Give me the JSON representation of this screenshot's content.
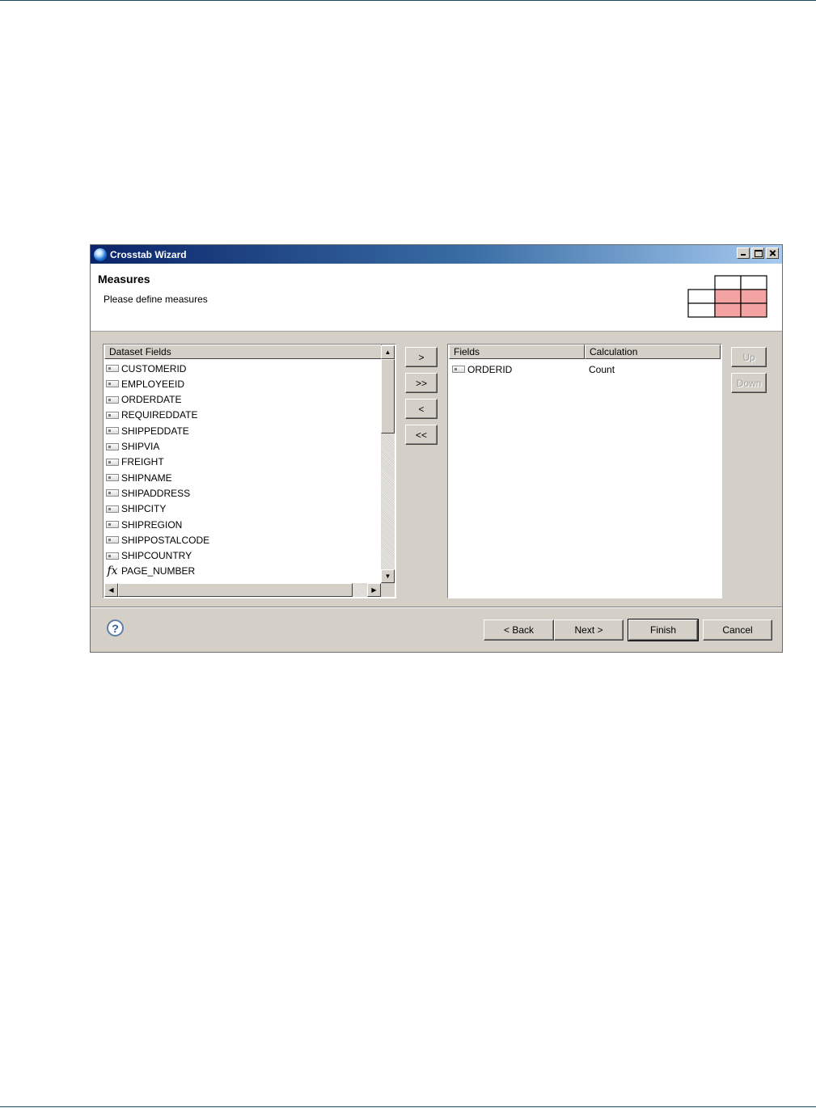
{
  "window": {
    "title": "Crosstab Wizard",
    "controls": {
      "minimize": "_",
      "maximize": "□",
      "close": "×"
    }
  },
  "header": {
    "title": "Measures",
    "description": "Please define measures"
  },
  "dataset_fields": {
    "header": "Dataset Fields",
    "items": [
      {
        "label": "CUSTOMERID",
        "icon": "field-icon"
      },
      {
        "label": "EMPLOYEEID",
        "icon": "field-icon"
      },
      {
        "label": "ORDERDATE",
        "icon": "field-icon"
      },
      {
        "label": "REQUIREDDATE",
        "icon": "field-icon"
      },
      {
        "label": "SHIPPEDDATE",
        "icon": "field-icon"
      },
      {
        "label": "SHIPVIA",
        "icon": "field-icon"
      },
      {
        "label": "FREIGHT",
        "icon": "field-icon"
      },
      {
        "label": "SHIPNAME",
        "icon": "field-icon"
      },
      {
        "label": "SHIPADDRESS",
        "icon": "field-icon"
      },
      {
        "label": "SHIPCITY",
        "icon": "field-icon"
      },
      {
        "label": "SHIPREGION",
        "icon": "field-icon"
      },
      {
        "label": "SHIPPOSTALCODE",
        "icon": "field-icon"
      },
      {
        "label": "SHIPCOUNTRY",
        "icon": "field-icon"
      },
      {
        "label": "PAGE_NUMBER",
        "icon": "fx-icon"
      }
    ]
  },
  "transfer_buttons": {
    "add": ">",
    "add_all": ">>",
    "remove": "<",
    "remove_all": "<<"
  },
  "measures": {
    "columns": [
      "Fields",
      "Calculation"
    ],
    "rows": [
      {
        "field": "ORDERID",
        "calculation": "Count"
      }
    ]
  },
  "order_buttons": {
    "up": "Up",
    "down": "Down"
  },
  "footer": {
    "back": "< Back",
    "next": "Next >",
    "finish": "Finish",
    "cancel": "Cancel",
    "help": "?"
  },
  "colors": {
    "title_bar_start": "#0a246a",
    "title_bar_end": "#a6caf0",
    "dialog_bg": "#d4d0c8",
    "grid_highlight": "#f4a3a3"
  }
}
